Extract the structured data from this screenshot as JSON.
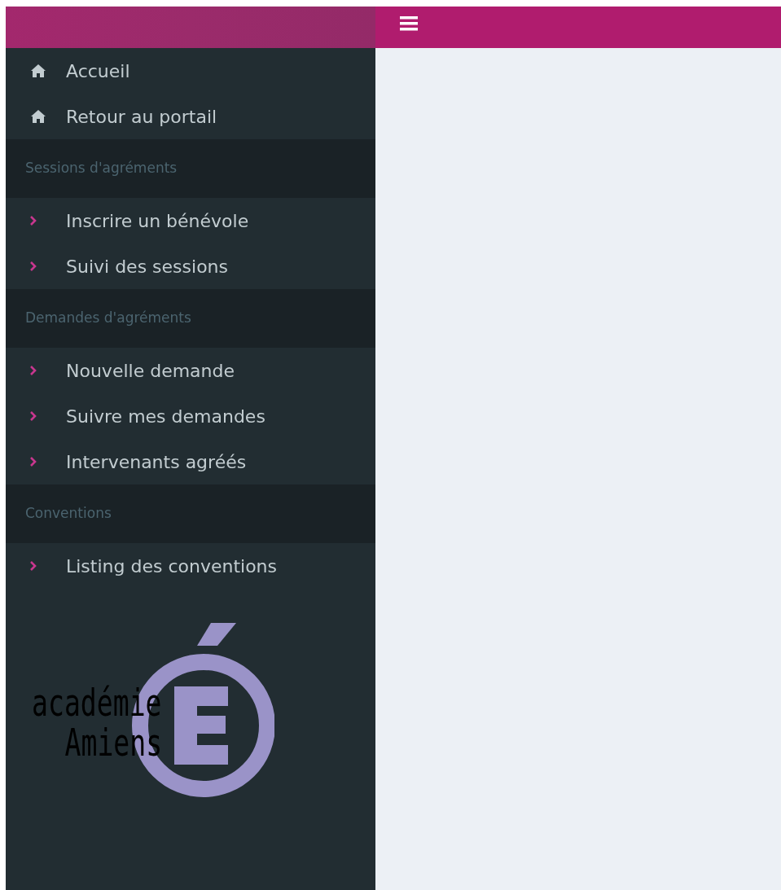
{
  "sidebar": {
    "items": [
      {
        "kind": "home",
        "label": "Accueil"
      },
      {
        "kind": "home",
        "label": "Retour au portail"
      },
      {
        "kind": "header",
        "label": "Sessions d'agréments"
      },
      {
        "kind": "link",
        "label": "Inscrire un bénévole"
      },
      {
        "kind": "link",
        "label": "Suivi des sessions"
      },
      {
        "kind": "header",
        "label": "Demandes d'agréments"
      },
      {
        "kind": "link",
        "label": "Nouvelle demande"
      },
      {
        "kind": "link",
        "label": "Suivre mes demandes"
      },
      {
        "kind": "link",
        "label": "Intervenants agréés"
      },
      {
        "kind": "header",
        "label": "Conventions"
      },
      {
        "kind": "link",
        "label": "Listing des conventions"
      }
    ],
    "logo": {
      "line_1": "académie",
      "line_2": "Amiens"
    }
  }
}
